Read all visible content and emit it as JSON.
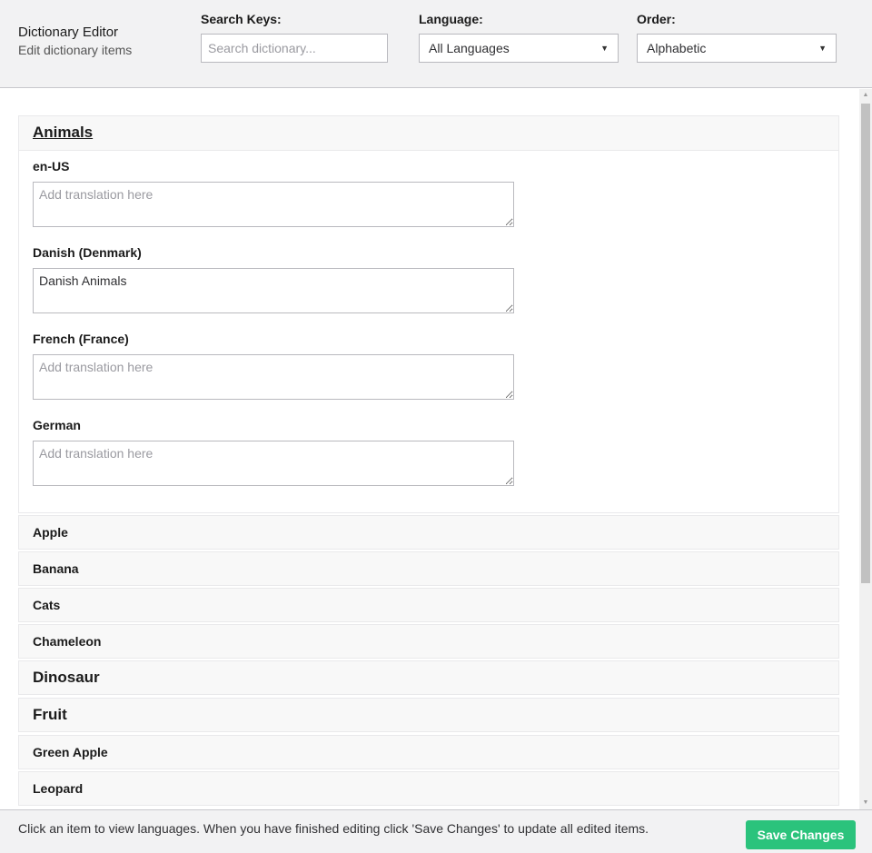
{
  "header": {
    "title": "Dictionary Editor",
    "subtitle": "Edit dictionary items",
    "search": {
      "label": "Search Keys:",
      "placeholder": "Search dictionary...",
      "value": ""
    },
    "language": {
      "label": "Language:",
      "selected": "All Languages"
    },
    "order": {
      "label": "Order:",
      "selected": "Alphabetic"
    }
  },
  "expanded_item": {
    "title": "Animals",
    "languages": [
      {
        "label": "en-US",
        "value": "",
        "placeholder": "Add translation here"
      },
      {
        "label": "Danish (Denmark)",
        "value": "Danish Animals",
        "placeholder": "Add translation here"
      },
      {
        "label": "French (France)",
        "value": "",
        "placeholder": "Add translation here"
      },
      {
        "label": "German",
        "value": "",
        "placeholder": "Add translation here"
      }
    ]
  },
  "items": [
    "Apple",
    "Banana",
    "Cats",
    "Chameleon",
    "Dinosaur",
    "Fruit",
    "Green Apple",
    "Leopard"
  ],
  "footer": {
    "text": "Click an item to view languages. When you have finished editing click 'Save Changes' to update all edited items.",
    "save_label": "Save Changes"
  },
  "colors": {
    "accent": "#2bc37c",
    "header_bg": "#f2f2f3"
  }
}
